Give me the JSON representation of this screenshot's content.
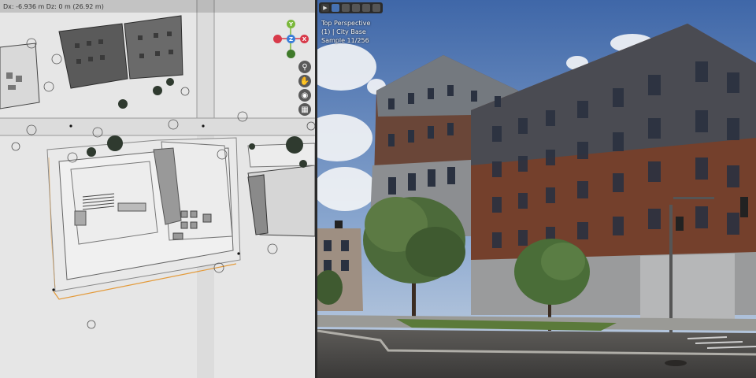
{
  "left_viewport": {
    "measure_readout": "Dx: -6.936 m  Dz: 0 m (26.92 m)",
    "gizmo": {
      "y_label": "Y",
      "x_label": "X",
      "z_label": "Z"
    },
    "nav_tools": [
      "zoom-icon",
      "hand-pan-icon",
      "camera-icon",
      "grid-icon"
    ]
  },
  "right_viewport": {
    "view_name": "Top Perspective",
    "collection": "(1) | City Base",
    "sample": "Sample 11/256",
    "toolbar": [
      "play-icon",
      "shading-solid-icon",
      "shading-material-icon",
      "shading-rendered-icon",
      "shading-wire-icon",
      "options-icon"
    ]
  },
  "colors": {
    "accent_blue": "#4772b3",
    "axis_x": "#d83a4a",
    "axis_y": "#7ab83b",
    "axis_z": "#3b7ed8"
  }
}
